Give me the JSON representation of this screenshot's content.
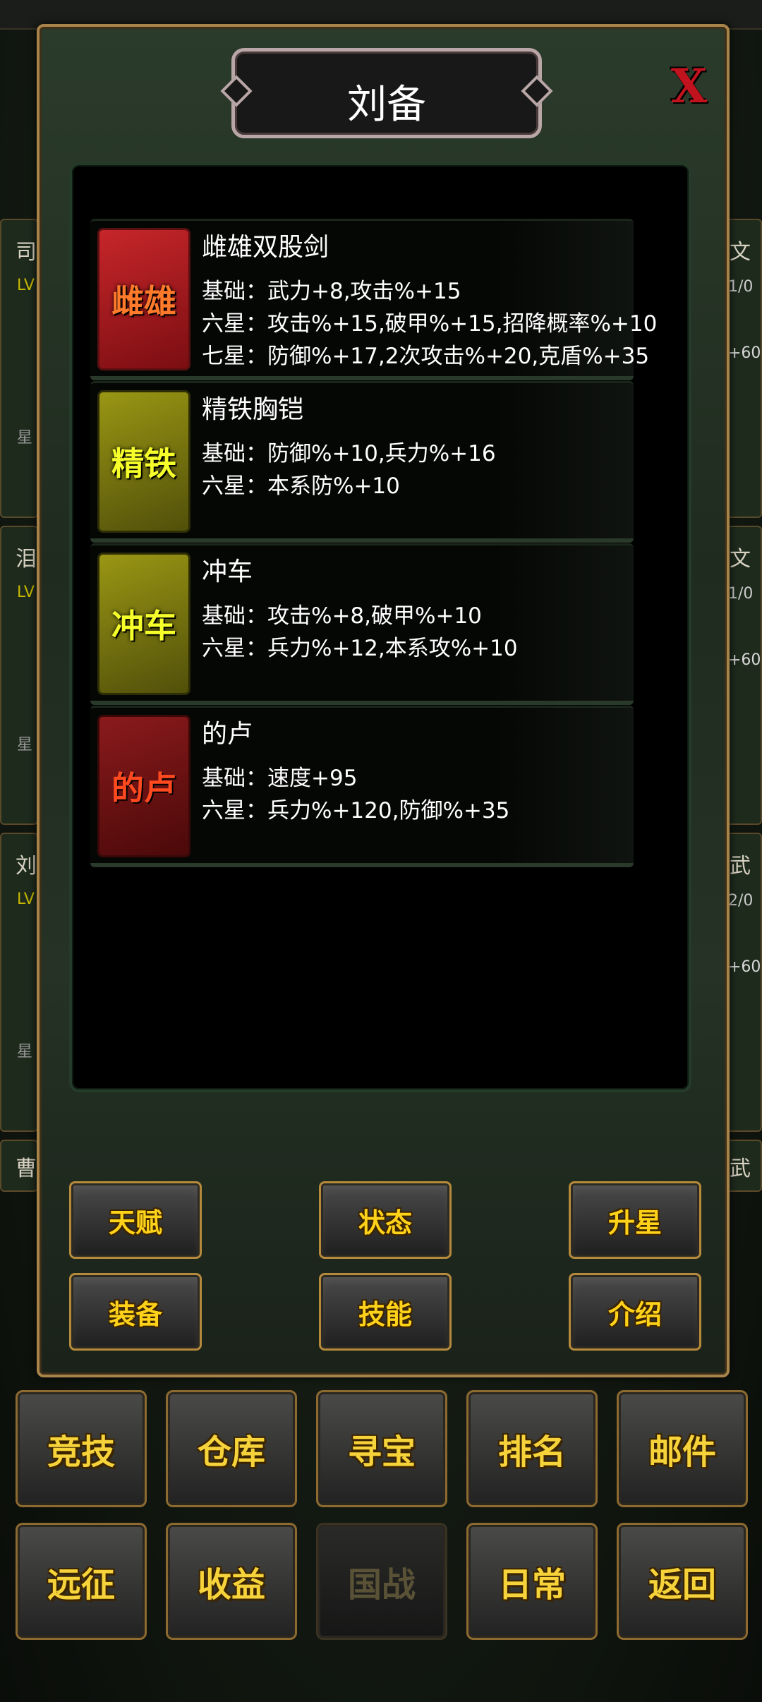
{
  "dialog": {
    "title": "刘备",
    "close_label": "X"
  },
  "equipment": [
    {
      "icon_text": "雌雄",
      "name": "雌雄双股剑",
      "lines": [
        "基础：武力+8,攻击%+15",
        "六星：攻击%+15,破甲%+15,招降概率%+10",
        "七星：防御%+17,2次攻击%+20,克盾%+35"
      ]
    },
    {
      "icon_text": "精铁",
      "name": "精铁胸铠",
      "lines": [
        "基础：防御%+10,兵力%+16",
        "六星：本系防%+10"
      ]
    },
    {
      "icon_text": "冲车",
      "name": "冲车",
      "lines": [
        "基础：攻击%+8,破甲%+10",
        "六星：兵力%+12,本系攻%+10"
      ]
    },
    {
      "icon_text": "的卢",
      "name": "的卢",
      "lines": [
        "基础：速度+95",
        "六星：兵力%+120,防御%+35"
      ]
    }
  ],
  "dialog_buttons": [
    "天赋",
    "状态",
    "升星",
    "装备",
    "技能",
    "介绍"
  ],
  "bottom_menu": {
    "row1": [
      "竞技",
      "仓库",
      "寻宝",
      "排名",
      "邮件"
    ],
    "row2": [
      "远征",
      "收益",
      "国战",
      "日常",
      "返回"
    ]
  },
  "background_cards": {
    "left_chars": [
      "司",
      "泪",
      "刘",
      "曹"
    ],
    "right_chars": [
      "文",
      "文",
      "武",
      "武"
    ],
    "lv_text": "LV",
    "star_text": "星",
    "right_counts": [
      "1/0",
      "1/0",
      "2/0"
    ],
    "right_bonus": "+60"
  }
}
